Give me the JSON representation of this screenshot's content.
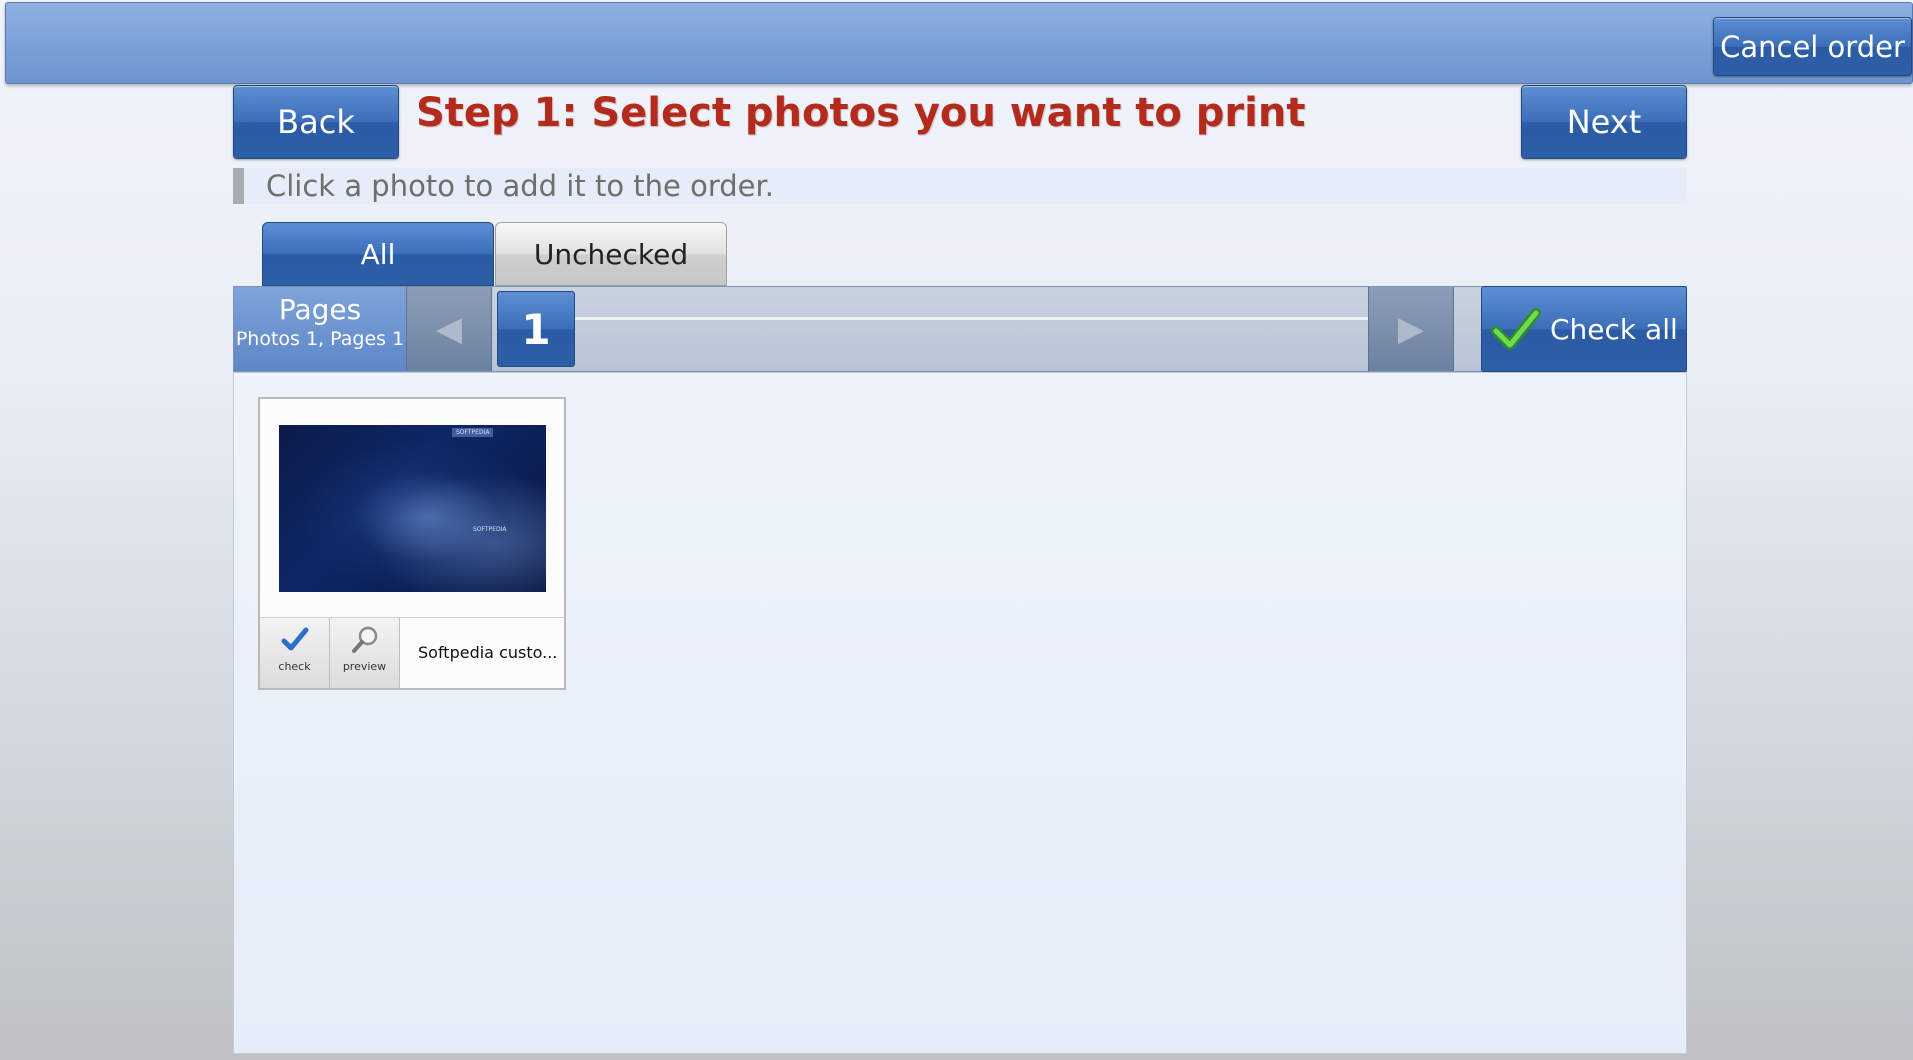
{
  "header": {
    "cancel_label": "Cancel order"
  },
  "nav": {
    "back_label": "Back",
    "next_label": "Next",
    "step_title": "Step 1: Select photos you want to print",
    "hint": "Click a photo to add it to the order."
  },
  "tabs": [
    {
      "label": "All",
      "active": true
    },
    {
      "label": "Unchecked",
      "active": false
    }
  ],
  "pager": {
    "title": "Pages",
    "summary": "Photos 1, Pages 1",
    "current_page": "1",
    "check_all_label": "Check all"
  },
  "photos": [
    {
      "name": "Softpedia custo...",
      "check_label": "check",
      "preview_label": "preview",
      "thumb_text": [
        "SOFTPEDIA",
        "SOFTPEDIA"
      ]
    }
  ],
  "colors": {
    "accent_blue": "#3b6eb9",
    "title_red": "#b32b1c",
    "check_green": "#3cb43c"
  },
  "icons": {
    "check_all": "green-check-icon",
    "photo_check": "blue-check-icon",
    "photo_preview": "magnifier-icon",
    "prev": "left-arrow-icon",
    "next": "right-arrow-icon"
  }
}
